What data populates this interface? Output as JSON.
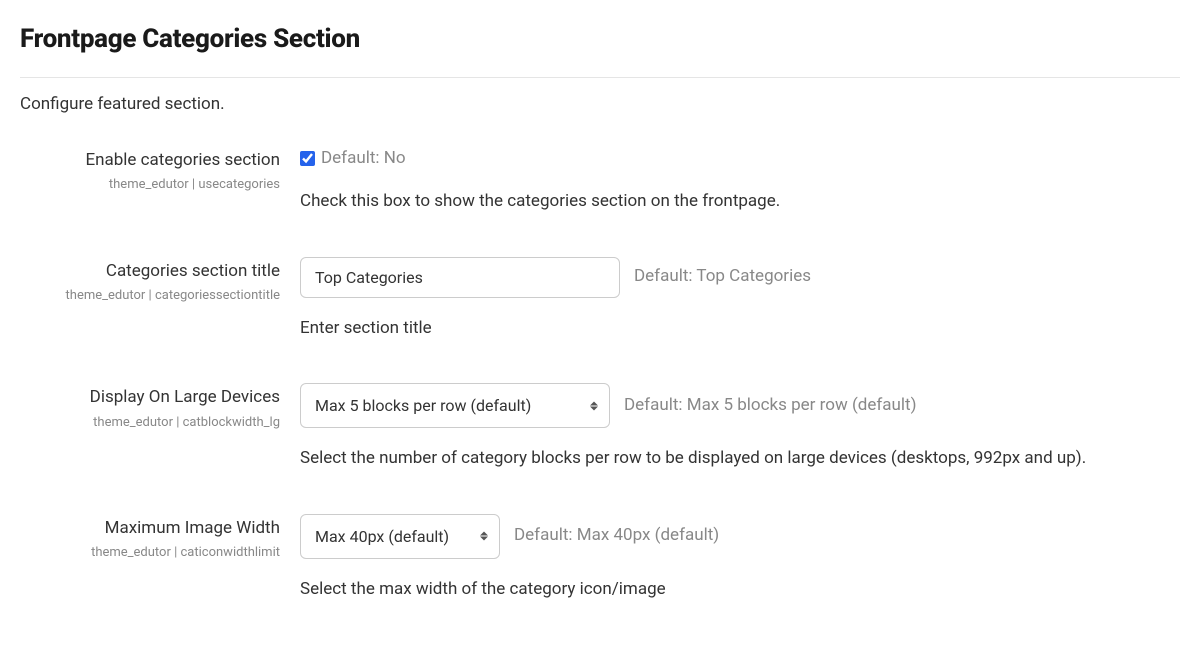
{
  "section": {
    "title": "Frontpage Categories Section",
    "description": "Configure featured section."
  },
  "fields": {
    "enable": {
      "label": "Enable categories section",
      "key": "theme_edutor | usecategories",
      "checked": true,
      "default": "Default: No",
      "help": "Check this box to show the categories section on the frontpage."
    },
    "title": {
      "label": "Categories section title",
      "key": "theme_edutor | categoriessectiontitle",
      "value": "Top Categories",
      "default": "Default: Top Categories",
      "help": "Enter section title"
    },
    "display_lg": {
      "label": "Display On Large Devices",
      "key": "theme_edutor | catblockwidth_lg",
      "value": "Max 5 blocks per row (default)",
      "default": "Default: Max 5 blocks per row (default)",
      "help": "Select the number of category blocks per row to be displayed on large devices (desktops, 992px and up)."
    },
    "img_width": {
      "label": "Maximum Image Width",
      "key": "theme_edutor | caticonwidthlimit",
      "value": "Max 40px (default)",
      "default": "Default: Max 40px (default)",
      "help": "Select the max width of the category icon/image"
    }
  }
}
